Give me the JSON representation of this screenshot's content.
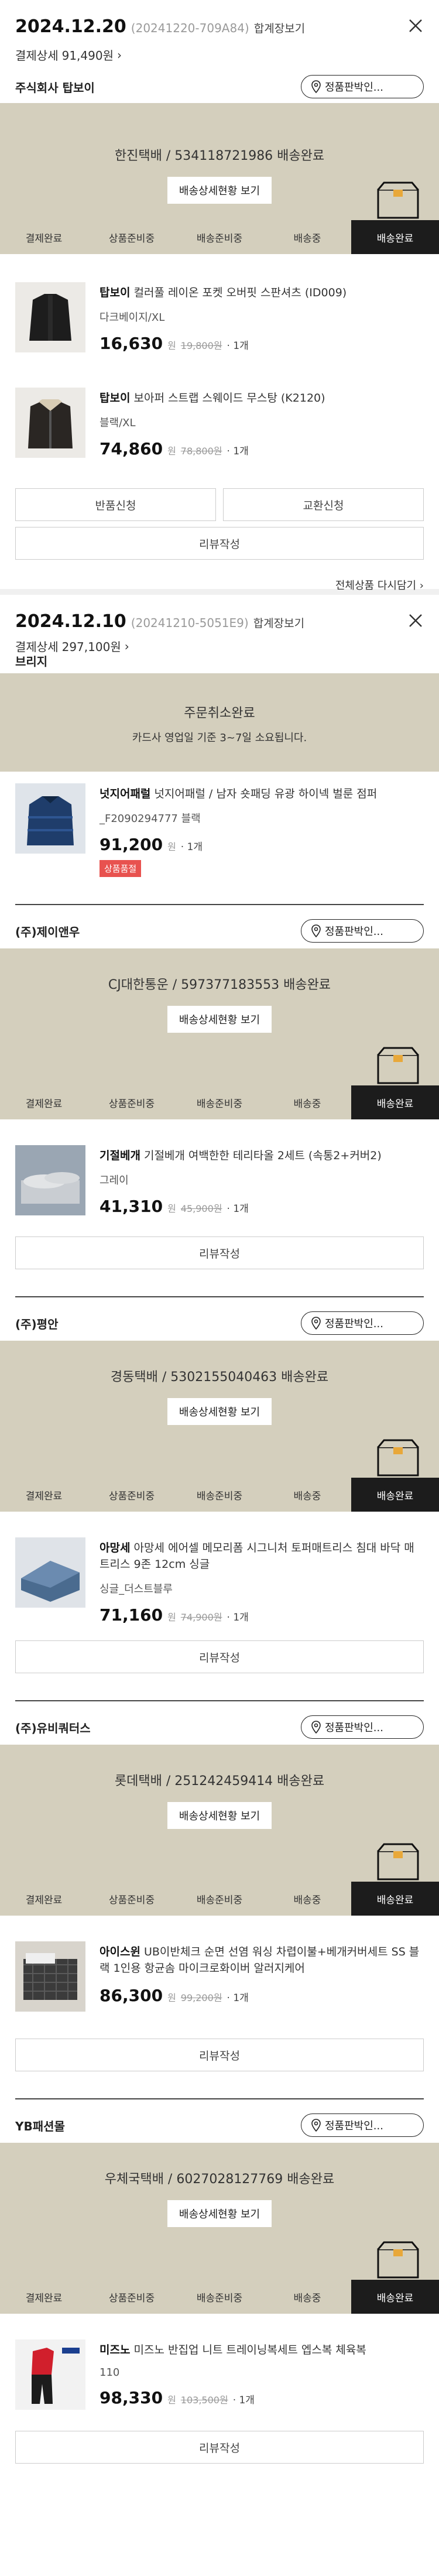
{
  "labels": {
    "won": "원",
    "merge_view": "합계장보기",
    "pay_detail": "결제상세",
    "genuine_btn": "정품판박인...",
    "ship_detail_btn": "배송상세현황 보기",
    "return_btn": "반품신청",
    "exchange_btn": "교환신청",
    "review_btn": "리뷰작성",
    "all_products": "전체상품 다시담기",
    "steps": [
      "결제완료",
      "상품준비중",
      "배송준비중",
      "배송중",
      "배송완료"
    ]
  },
  "orders": [
    {
      "date": "2024.12.20",
      "order_no": "(20241220-709A84)",
      "pay_amount": "91,490원",
      "sellers": [
        {
          "name": "주식회사 탑보이",
          "shipping": "한진택배 / 534118721986 배송완료",
          "products": [
            {
              "brand": "탑보이",
              "name": "컬러풀 레이온 포켓 오버핏 스판셔츠 (ID009)",
              "option": "다크베이지/XL",
              "price": "16,630",
              "orig": "19,800원",
              "qty": "· 1개"
            },
            {
              "brand": "탑보이",
              "name": "보아퍼 스트랩 스웨이드 무스탕 (K2120)",
              "option": "블랙/XL",
              "price": "74,860",
              "orig": "78,800원",
              "qty": "· 1개"
            }
          ]
        }
      ]
    },
    {
      "date": "2024.12.10",
      "order_no": "(20241210-5051E9)",
      "pay_amount": "297,100원",
      "cancel": {
        "title": "주문취소완료",
        "sub": "카드사 영업일 기준 3~7일 소요됩니다.",
        "seller": "브리지",
        "product": {
          "brand": "넛지어패럴",
          "name": "넛지어패럴 / 남자 숏패딩 유광 하이넥 벌룬 점퍼",
          "option": "_F2090294777 블랙",
          "price": "91,200",
          "qty": "· 1개",
          "tag": "상품품절"
        }
      },
      "sellers": [
        {
          "name": "(주)제이앤우",
          "shipping": "CJ대한통운 / 597377183553 배송완료",
          "product": {
            "brand": "기절베개",
            "name": "기절베개 여백한한 테리타올 2세트 (속통2+커버2)",
            "option": "그레이",
            "price": "41,310",
            "orig": "45,900원",
            "qty": "· 1개"
          }
        },
        {
          "name": "(주)평안",
          "shipping": "경동택배 / 5302155040463 배송완료",
          "product": {
            "brand": "아망세",
            "name": "아망세 에어셀 메모리폼 시그니처 토퍼매트리스 침대 바닥 매트리스 9존 12cm 싱글",
            "option": "싱글_더스트블루",
            "price": "71,160",
            "orig": "74,900원",
            "qty": "· 1개"
          }
        },
        {
          "name": "(주)유비쿼터스",
          "shipping": "롯데택배 / 251242459414 배송완료",
          "product": {
            "brand": "아이스윈",
            "name": "UB이반체크 순면 선염 워싱 차렵이불+베개커버세트 SS 블랙 1인용 항균솜 마이크로화이버 알러지케어",
            "option": "",
            "price": "86,300",
            "orig": "99,200원",
            "qty": "· 1개"
          }
        },
        {
          "name": "YB패션몰",
          "shipping": "우체국택배 / 6027028127769 배송완료",
          "product": {
            "brand": "미즈노",
            "name": "미즈노 반집업 니트 트레이닝복세트 엡스복 체육복",
            "option": "110",
            "price": "98,330",
            "orig": "103,500원",
            "qty": "· 1개"
          }
        }
      ]
    }
  ]
}
